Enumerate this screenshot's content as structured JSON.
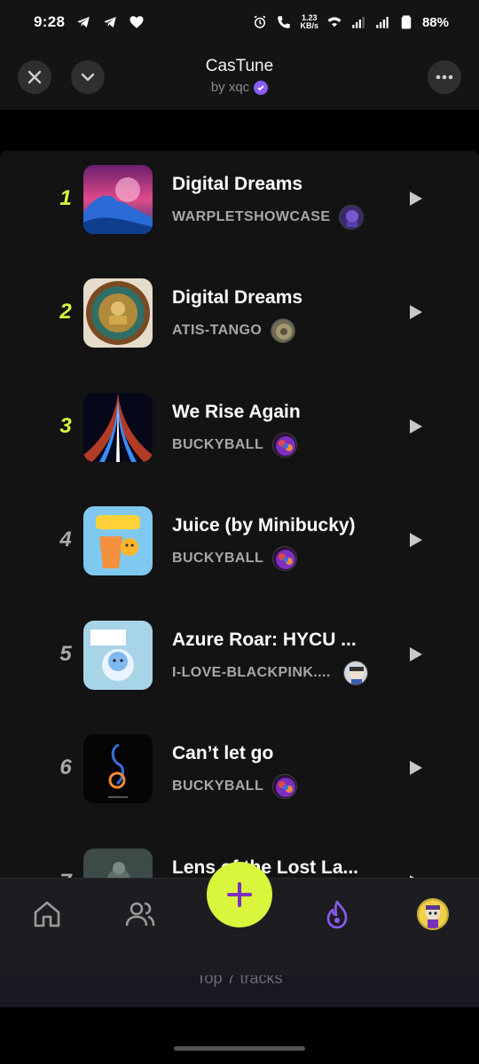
{
  "status_bar": {
    "time": "9:28",
    "speed_top": "1.23",
    "speed_bottom": "KB/s",
    "battery": "88%"
  },
  "header": {
    "title": "CasTune",
    "byline": "by xqc"
  },
  "tracks": [
    {
      "rank": "1",
      "title": "Digital Dreams",
      "artist": "WARPLETSHOWCASE",
      "rank_color": "#d9f53c"
    },
    {
      "rank": "2",
      "title": "Digital Dreams",
      "artist": "ATIS-TANGO",
      "rank_color": "#d9f53c"
    },
    {
      "rank": "3",
      "title": "We Rise Again",
      "artist": "BUCKYBALL",
      "rank_color": "#d9f53c"
    },
    {
      "rank": "4",
      "title": "Juice (by Minibucky)",
      "artist": "BUCKYBALL",
      "rank_color": "#a9a9a9"
    },
    {
      "rank": "5",
      "title": "Azure Roar: HYCU ...",
      "artist": "I-LOVE-BLACKPINK....",
      "rank_color": "#a9a9a9"
    },
    {
      "rank": "6",
      "title": "Can’t let go",
      "artist": "BUCKYBALL",
      "rank_color": "#a9a9a9"
    },
    {
      "rank": "7",
      "title": "Lens of the Lost La...",
      "artist": "",
      "rank_color": "#a9a9a9"
    }
  ],
  "nav": {
    "items": [
      "home-icon",
      "users-icon",
      "add-button",
      "flame-icon",
      "profile-avatar"
    ],
    "active_color": "#8b5cf6"
  },
  "footer": {
    "label": "Top 7 tracks"
  },
  "colors": {
    "accent": "#d9f53c",
    "purple": "#8b5cf6"
  }
}
